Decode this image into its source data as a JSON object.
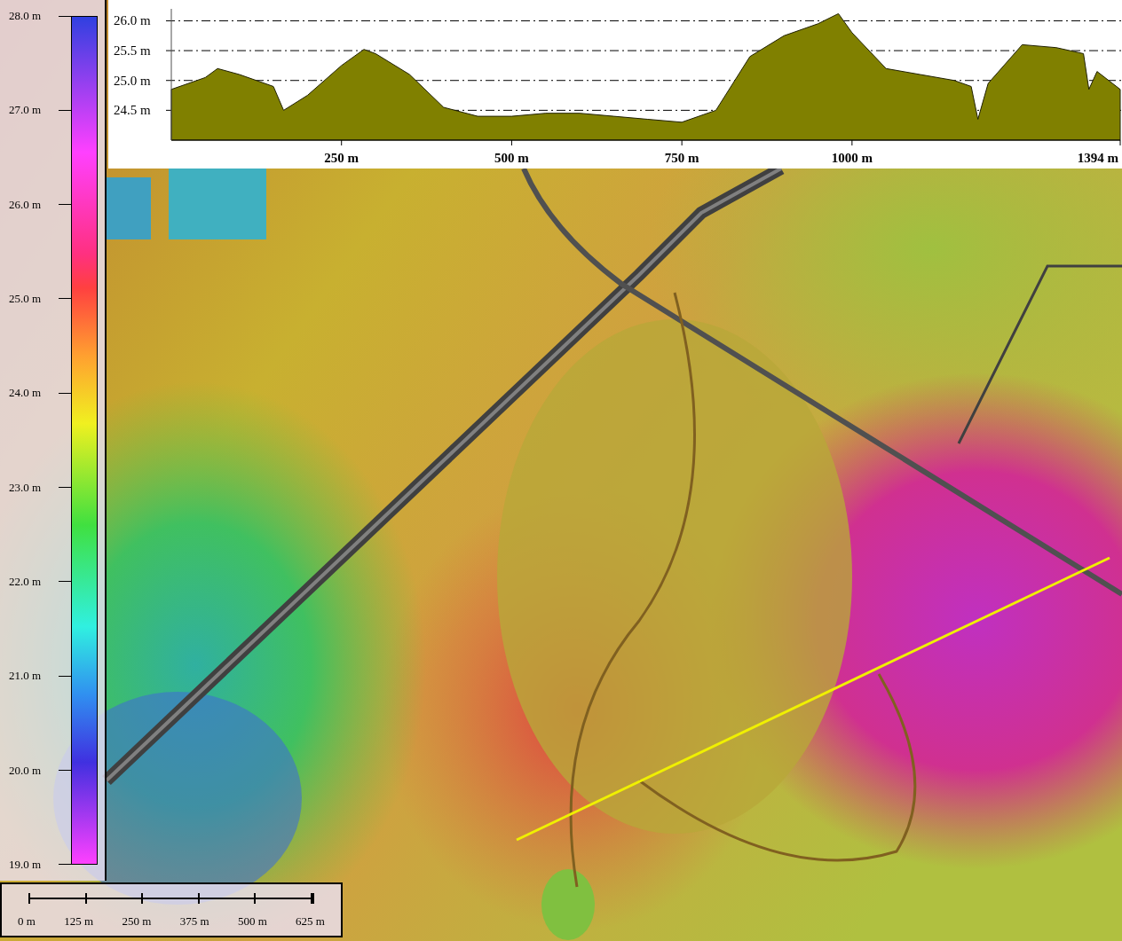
{
  "legend": {
    "labels": [
      "28.0 m",
      "27.0 m",
      "26.0 m",
      "25.0 m",
      "24.0 m",
      "23.0 m",
      "22.0 m",
      "21.0 m",
      "20.0 m",
      "19.0 m"
    ]
  },
  "profile": {
    "chart_data": {
      "type": "area",
      "x": [
        0,
        50,
        68,
        100,
        150,
        165,
        200,
        250,
        283,
        300,
        350,
        400,
        450,
        500,
        550,
        600,
        650,
        700,
        750,
        800,
        850,
        900,
        950,
        980,
        1000,
        1050,
        1100,
        1150,
        1175,
        1185,
        1200,
        1250,
        1300,
        1340,
        1348,
        1360,
        1394
      ],
      "series": [
        {
          "color": "#808000",
          "values": [
            24.85,
            25.05,
            25.2,
            25.1,
            24.9,
            24.5,
            24.75,
            25.25,
            25.52,
            25.45,
            25.1,
            24.55,
            24.4,
            24.4,
            24.45,
            24.45,
            24.4,
            24.35,
            24.3,
            24.5,
            25.4,
            25.75,
            25.95,
            26.12,
            25.8,
            25.2,
            25.1,
            25.0,
            24.9,
            24.35,
            24.95,
            25.6,
            25.55,
            25.45,
            24.85,
            25.15,
            24.85
          ]
        }
      ],
      "xlim": [
        0,
        1394
      ],
      "ylim": [
        24.0,
        26.2
      ],
      "grid": true,
      "xticks": [
        {
          "value": 250,
          "label": "250 m"
        },
        {
          "value": 500,
          "label": "500 m"
        },
        {
          "value": 750,
          "label": "750 m"
        },
        {
          "value": 1000,
          "label": "1000 m"
        },
        {
          "value": 1394,
          "label": "1394 m"
        }
      ],
      "yticks": [
        {
          "value": 24.5,
          "label": "24.5 m"
        },
        {
          "value": 25.0,
          "label": "25.0 m"
        },
        {
          "value": 25.5,
          "label": "25.5 m"
        },
        {
          "value": 26.0,
          "label": "26.0 m"
        }
      ]
    }
  },
  "scale_bar": {
    "labels": [
      "0 m",
      "125 m",
      "250 m",
      "375 m",
      "500 m",
      "625 m"
    ]
  }
}
